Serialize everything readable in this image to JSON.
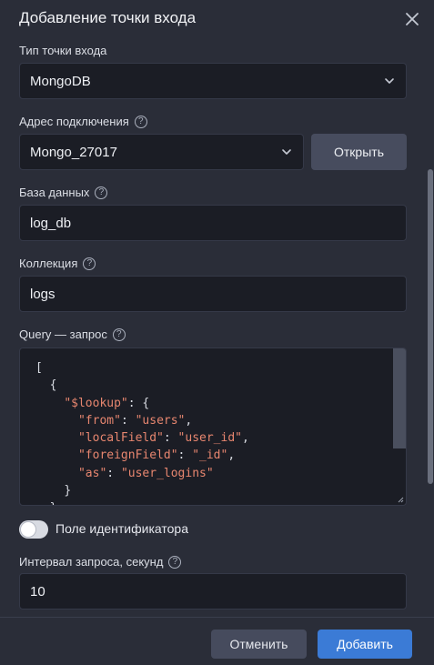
{
  "dialog": {
    "title": "Добавление точки входа"
  },
  "form": {
    "entry_type": {
      "label": "Тип точки входа",
      "value": "MongoDB"
    },
    "connection": {
      "label": "Адрес подключения",
      "value": "Mongo_27017",
      "open_button": "Открыть"
    },
    "database": {
      "label": "База данных",
      "value": "log_db"
    },
    "collection": {
      "label": "Коллекция",
      "value": "logs"
    },
    "query": {
      "label": "Query — запрос",
      "lines": [
        {
          "indent": "",
          "parts": [
            {
              "t": "p",
              "s": "["
            }
          ]
        },
        {
          "indent": "  ",
          "parts": [
            {
              "t": "p",
              "s": "{"
            }
          ]
        },
        {
          "indent": "    ",
          "parts": [
            {
              "t": "k",
              "s": "\"$lookup\""
            },
            {
              "t": "p",
              "s": ": {"
            }
          ]
        },
        {
          "indent": "      ",
          "parts": [
            {
              "t": "k",
              "s": "\"from\""
            },
            {
              "t": "p",
              "s": ": "
            },
            {
              "t": "k",
              "s": "\"users\""
            },
            {
              "t": "p",
              "s": ","
            }
          ]
        },
        {
          "indent": "      ",
          "parts": [
            {
              "t": "k",
              "s": "\"localField\""
            },
            {
              "t": "p",
              "s": ": "
            },
            {
              "t": "k",
              "s": "\"user_id\""
            },
            {
              "t": "p",
              "s": ","
            }
          ]
        },
        {
          "indent": "      ",
          "parts": [
            {
              "t": "k",
              "s": "\"foreignField\""
            },
            {
              "t": "p",
              "s": ": "
            },
            {
              "t": "k",
              "s": "\"_id\""
            },
            {
              "t": "p",
              "s": ","
            }
          ]
        },
        {
          "indent": "      ",
          "parts": [
            {
              "t": "k",
              "s": "\"as\""
            },
            {
              "t": "p",
              "s": ": "
            },
            {
              "t": "k",
              "s": "\"user_logins\""
            }
          ]
        },
        {
          "indent": "    ",
          "parts": [
            {
              "t": "p",
              "s": "}"
            }
          ]
        },
        {
          "indent": "  ",
          "parts": [
            {
              "t": "p",
              "s": "},"
            }
          ]
        }
      ]
    },
    "id_field": {
      "label": "Поле идентификатора",
      "enabled": false
    },
    "interval": {
      "label": "Интервал запроса, секунд",
      "value": "10"
    }
  },
  "footer": {
    "cancel_label": "Отменить",
    "add_label": "Добавить"
  },
  "colors": {
    "accent": "#3b7bd6",
    "code_key": "#e7866f",
    "background": "#2a2d38",
    "field": "#1b1d25"
  }
}
